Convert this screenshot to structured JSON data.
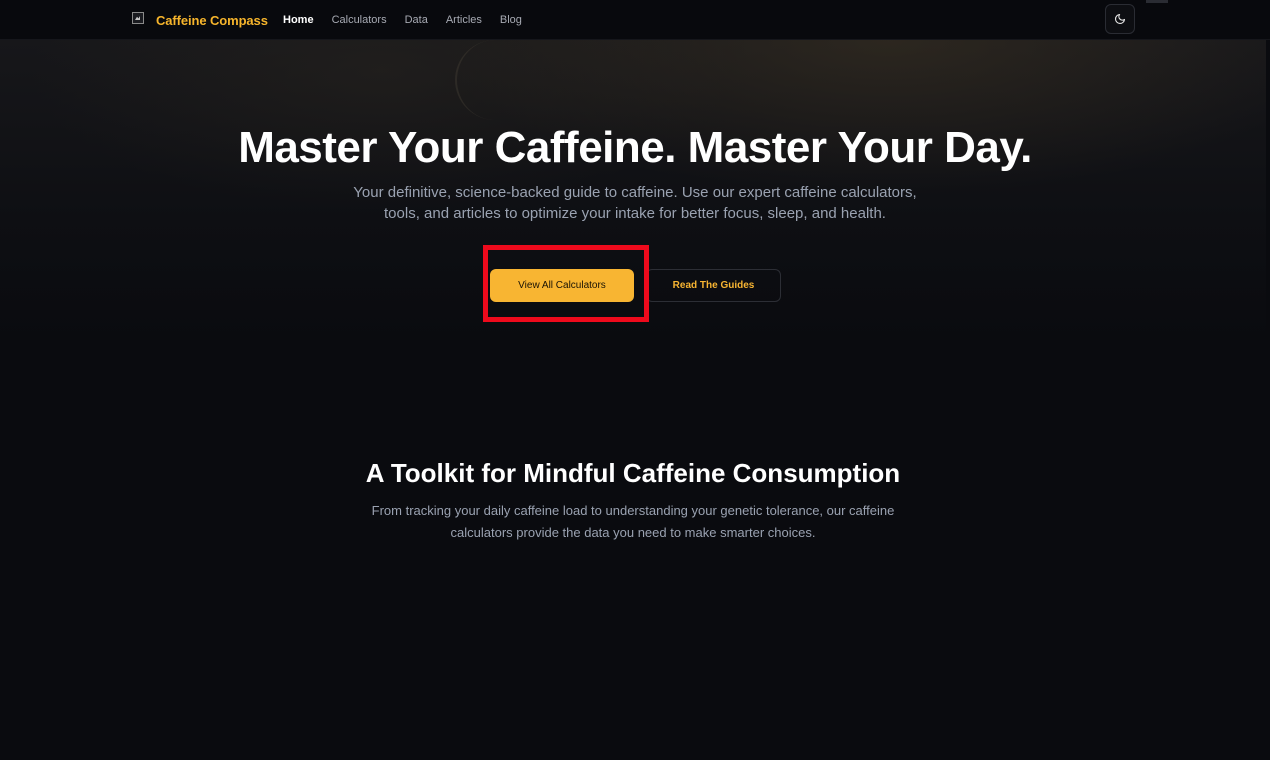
{
  "nav": {
    "brand_name": "Caffeine Compass",
    "links": [
      {
        "label": "Home",
        "active": true
      },
      {
        "label": "Calculators",
        "active": false
      },
      {
        "label": "Data",
        "active": false
      },
      {
        "label": "Articles",
        "active": false
      },
      {
        "label": "Blog",
        "active": false
      }
    ],
    "theme_toggle_icon": "moon-icon"
  },
  "hero": {
    "title": "Master Your Caffeine. Master Your Day.",
    "subtitle": "Your definitive, science-backed guide to caffeine. Use our expert caffeine calculators, tools, and articles to optimize your intake for better focus, sleep, and health.",
    "primary_button": "View All Calculators",
    "secondary_button": "Read The Guides"
  },
  "toolkit": {
    "title": "A Toolkit for Mindful Caffeine Consumption",
    "subtitle": "From tracking your daily caffeine load to understanding your genetic tolerance, our caffeine calculators provide the data you need to make smarter choices."
  },
  "colors": {
    "accent": "#f8b532",
    "background": "#0a0b0f",
    "highlight": "#ee0a1c",
    "muted_text": "#9aa2b1"
  }
}
